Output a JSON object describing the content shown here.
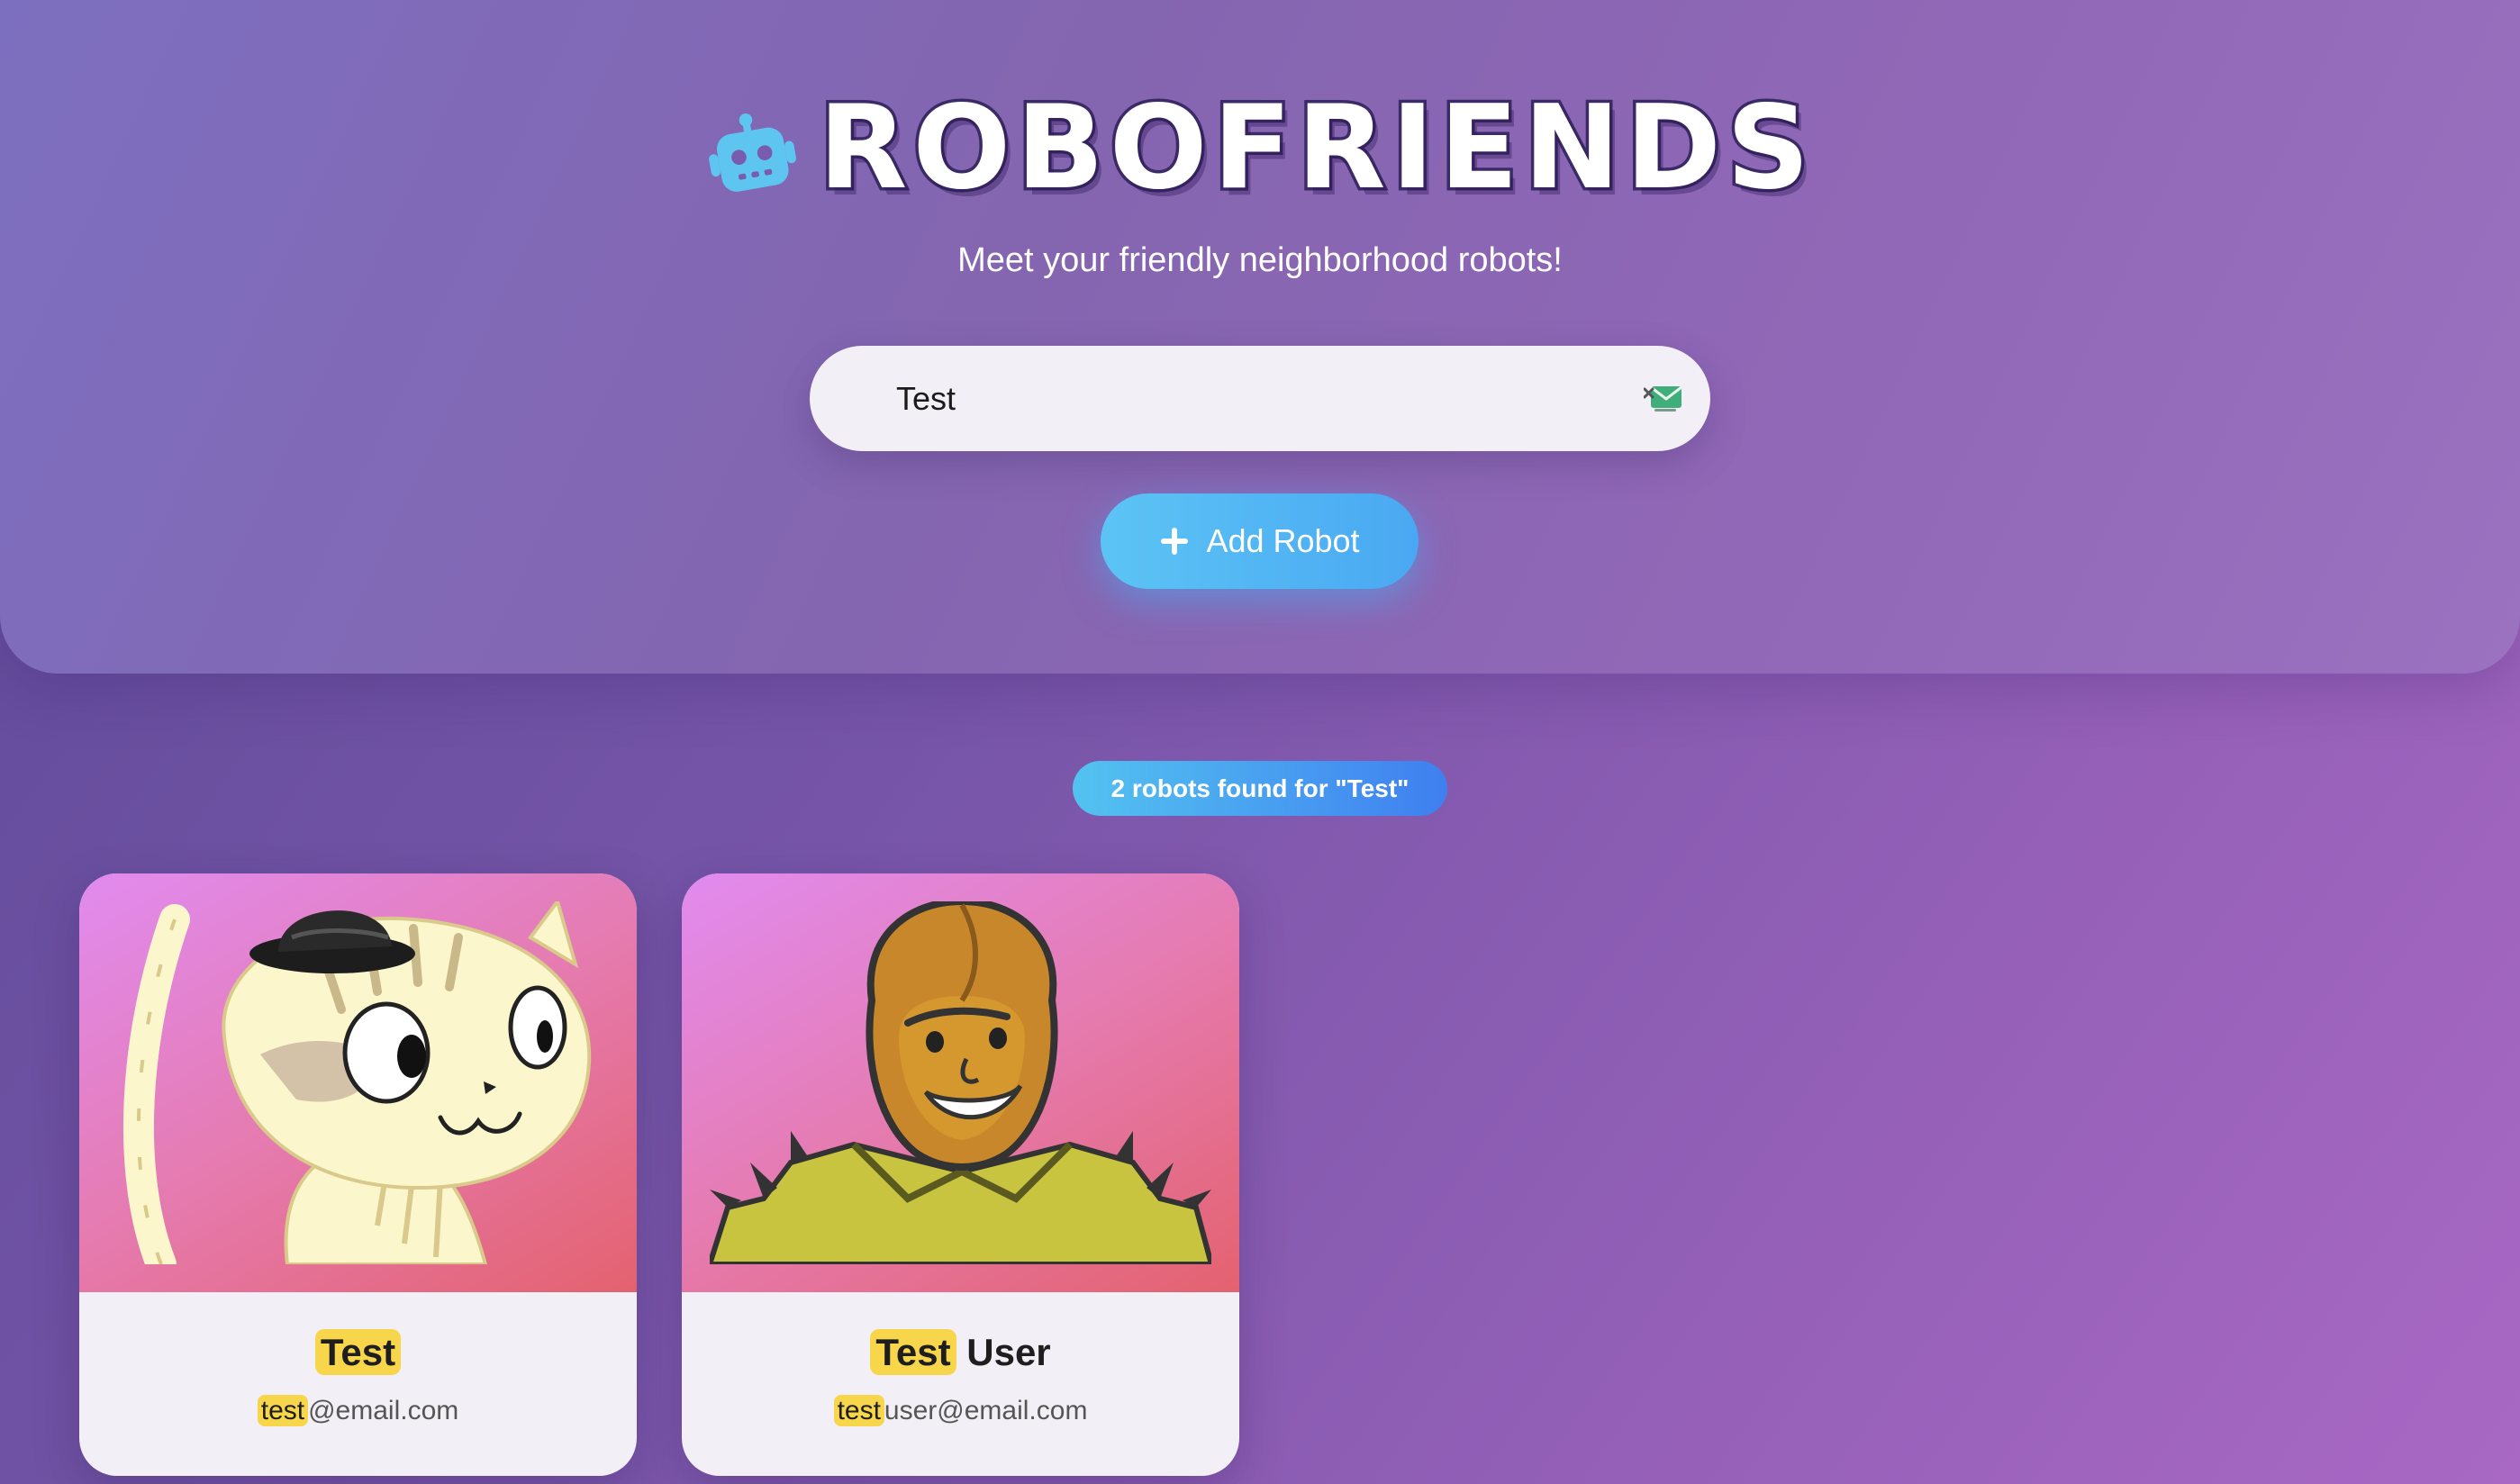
{
  "header": {
    "logo_icon": "robot-icon",
    "title": "ROBOFRIENDS",
    "subtitle": "Meet your friendly neighborhood robots!"
  },
  "search": {
    "value": "Test",
    "autofill_icon": "mail-autofill-icon"
  },
  "add_button": {
    "icon": "plus-icon",
    "label": "Add Robot"
  },
  "results": {
    "summary": "2 robots found for \"Test\""
  },
  "cards": [
    {
      "name_highlight": "Test",
      "name_rest": "",
      "email_highlight": "test",
      "email_rest": "@email.com",
      "avatar": "cat-with-bowler-hat"
    },
    {
      "name_highlight": "Test",
      "name_rest": "User",
      "email_highlight": "test",
      "email_rest": "user@email.com",
      "avatar": "golden-robot-with-spiked-shoulders"
    }
  ],
  "colors": {
    "accent_blue": "#4aa8f2",
    "highlight_yellow": "#f7d64c",
    "card_background": "#f3eff6"
  }
}
